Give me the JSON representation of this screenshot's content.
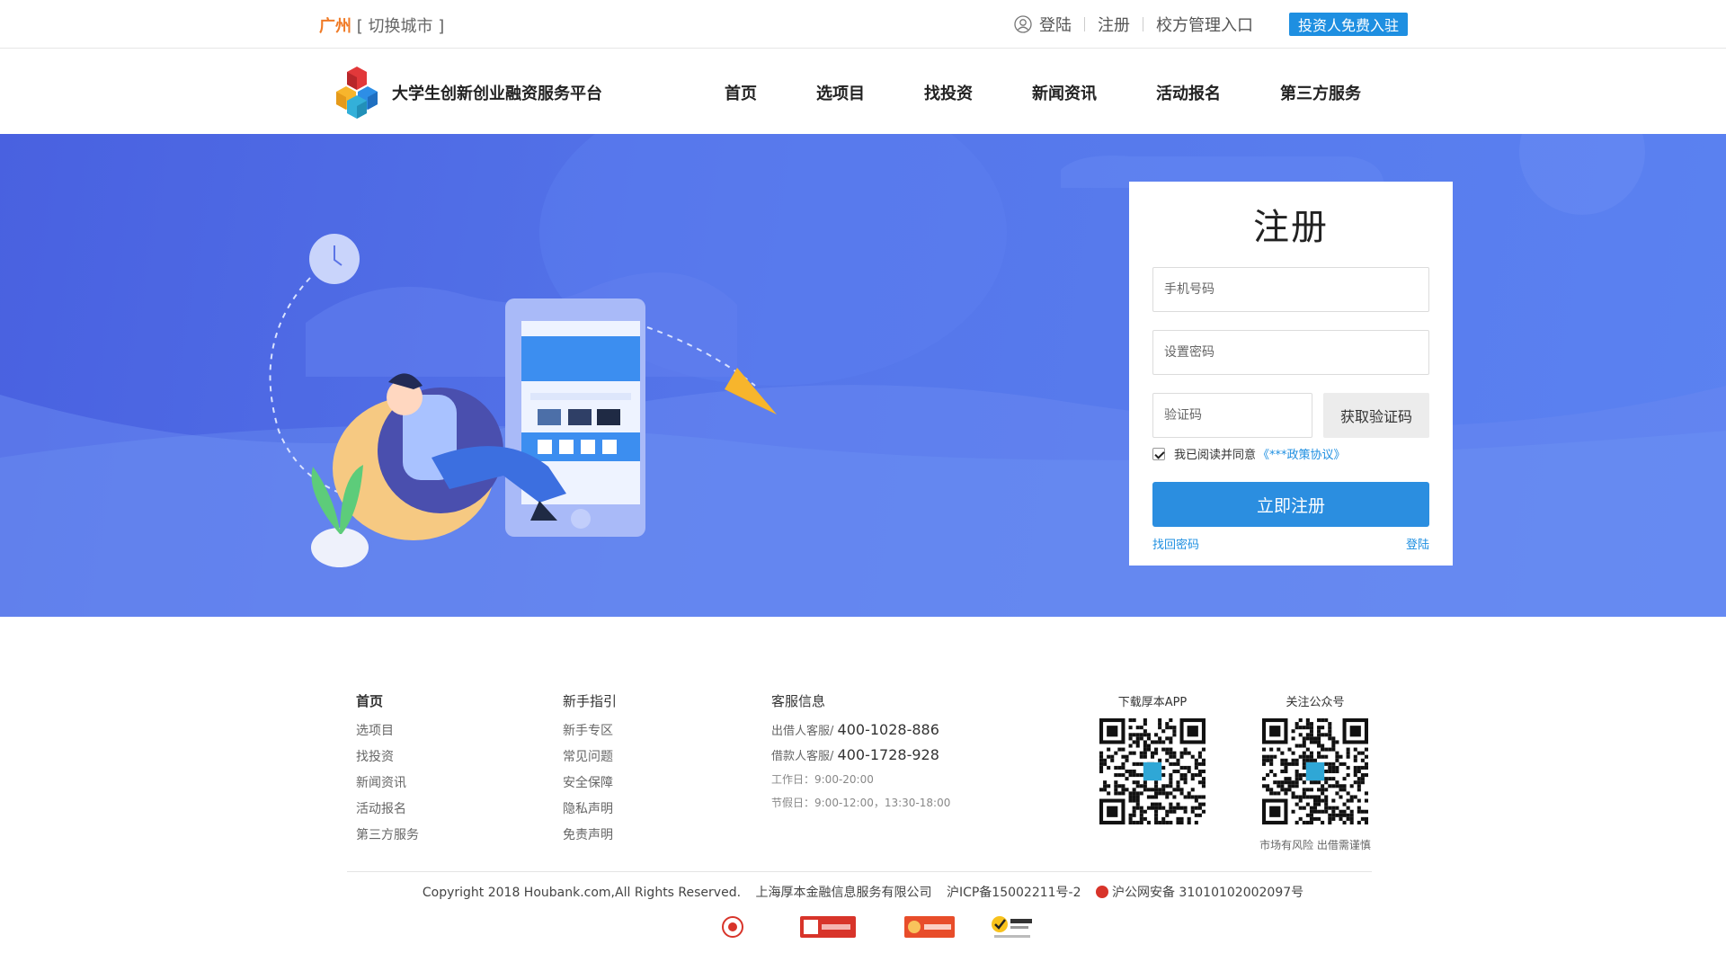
{
  "topbar": {
    "city": "广州",
    "switch_city": "[ 切换城市 ]",
    "login": "登陆",
    "register": "注册",
    "school_admin": "校方管理入口",
    "investor_entry": "投资人免费入驻"
  },
  "header": {
    "title": "大学生创新创业融资服务平台",
    "nav": [
      "首页",
      "选项目",
      "找投资",
      "新闻资讯",
      "活动报名",
      "第三方服务"
    ]
  },
  "register": {
    "title": "注册",
    "phone_placeholder": "手机号码",
    "password_placeholder": "设置密码",
    "code_placeholder": "验证码",
    "get_code": "获取验证码",
    "agree_text": "我已阅读并同意",
    "policy_link": "《***政策协议》",
    "agree_checked": true,
    "submit": "立即注册",
    "forgot": "找回密码",
    "login": "登陆"
  },
  "footer": {
    "col1": {
      "heading": "首页",
      "items": [
        "选项目",
        "找投资",
        "新闻资讯",
        "活动报名",
        "第三方服务"
      ]
    },
    "col2": {
      "heading": "新手指引",
      "items": [
        "新手专区",
        "常见问题",
        "安全保障",
        "隐私声明",
        "免责声明"
      ]
    },
    "col3": {
      "heading": "客服信息",
      "lender_label": "出借人客服/",
      "lender_phone": "400-1028-886",
      "borrower_label": "借款人客服/",
      "borrower_phone": "400-1728-928",
      "workday": "工作日：9:00-20:00",
      "holiday": "节假日：9:00-12:00，13:30-18:00"
    },
    "qr_app": "下载厚本APP",
    "qr_wechat": "关注公众号",
    "risk": "市场有风险 出借需谨慎",
    "copyright": "Copyright 2018 Houbank.com,All Rights Reserved.",
    "company": "上海厚本金融信息服务有限公司",
    "icp": "沪ICP备15002211号-2",
    "police": "沪公网安备 31010102002097号"
  },
  "colors": {
    "accent": "#1e8fe1",
    "banner": "#5576ea",
    "city": "#f07b27"
  }
}
